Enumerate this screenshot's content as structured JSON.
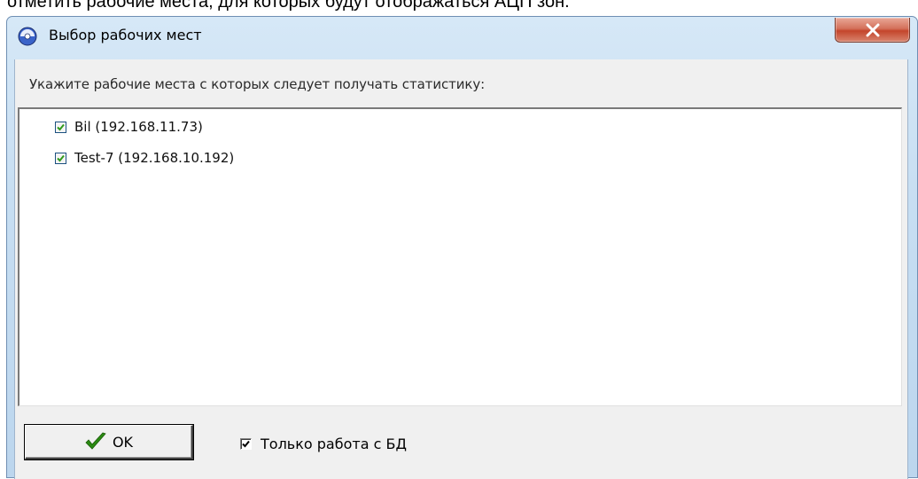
{
  "background_text": "отметить рабочие места, для которых будут отображаться АЦП зон.",
  "window": {
    "title": "Выбор рабочих мест",
    "close_label": "X"
  },
  "hint": "Укажите рабочие места с которых следует получать статистику:",
  "workstations": [
    {
      "label": "Bil (192.168.11.73)",
      "checked": true
    },
    {
      "label": "Test-7 (192.168.10.192)",
      "checked": true
    }
  ],
  "footer": {
    "ok_label": "OK",
    "db_only_label": "Только работа с БД",
    "db_only_checked": true
  },
  "colors": {
    "title_bar": "#c7def2",
    "close_button": "#c4452b",
    "checkmark_green": "#2f9a1a",
    "ok_icon_green": "#2a8a12"
  }
}
